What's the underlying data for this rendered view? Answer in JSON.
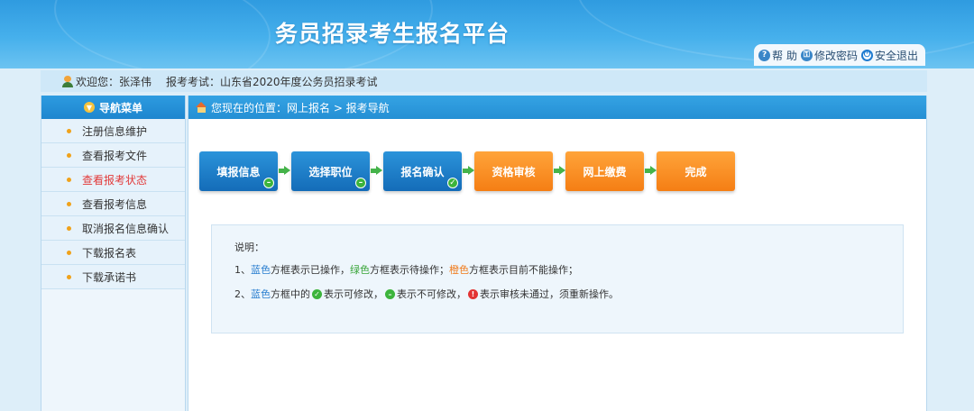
{
  "header": {
    "title": "务员招录考生报名平台",
    "help_label": "帮 助",
    "change_password_label": "修改密码",
    "logout_label": "安全退出"
  },
  "infobar": {
    "welcome": "欢迎您：张泽伟",
    "exam": "报考考试：山东省2020年度公务员招录考试"
  },
  "sidebar": {
    "title": "导航菜单",
    "items": [
      {
        "label": "注册信息维护"
      },
      {
        "label": "查看报考文件"
      },
      {
        "label": "查看报考状态"
      },
      {
        "label": "查看报考信息"
      },
      {
        "label": "取消报名信息确认"
      },
      {
        "label": "下载报名表"
      },
      {
        "label": "下载承诺书"
      }
    ]
  },
  "location": {
    "text": "您现在的位置：网上报名 > 报考导航"
  },
  "steps": [
    {
      "label": "填报信息",
      "color": "blue",
      "mark": "dash"
    },
    {
      "label": "选择职位",
      "color": "blue",
      "mark": "dash"
    },
    {
      "label": "报名确认",
      "color": "blue",
      "mark": "check"
    },
    {
      "label": "资格审核",
      "color": "orange",
      "mark": ""
    },
    {
      "label": "网上缴费",
      "color": "orange",
      "mark": ""
    },
    {
      "label": "完成",
      "color": "orange",
      "mark": ""
    }
  ],
  "note": {
    "title": "说明：",
    "l1_prefix": "1、",
    "l1_blue": "蓝色",
    "l1_a": "方框表示已操作，",
    "l1_green": "绿色",
    "l1_b": "方框表示待操作；",
    "l1_orange": "橙色",
    "l1_c": "方框表示目前不能操作；",
    "l2_prefix": "2、",
    "l2_blue": "蓝色",
    "l2_a": "方框中的",
    "l2_b": "表示可修改，",
    "l2_c": "表示不可修改，",
    "l2_d": "表示审核未通过，须重新操作。"
  },
  "colors": {
    "blue": "#146cb8",
    "orange": "#f57e14",
    "green": "#3cb43c",
    "red": "#e23434"
  }
}
